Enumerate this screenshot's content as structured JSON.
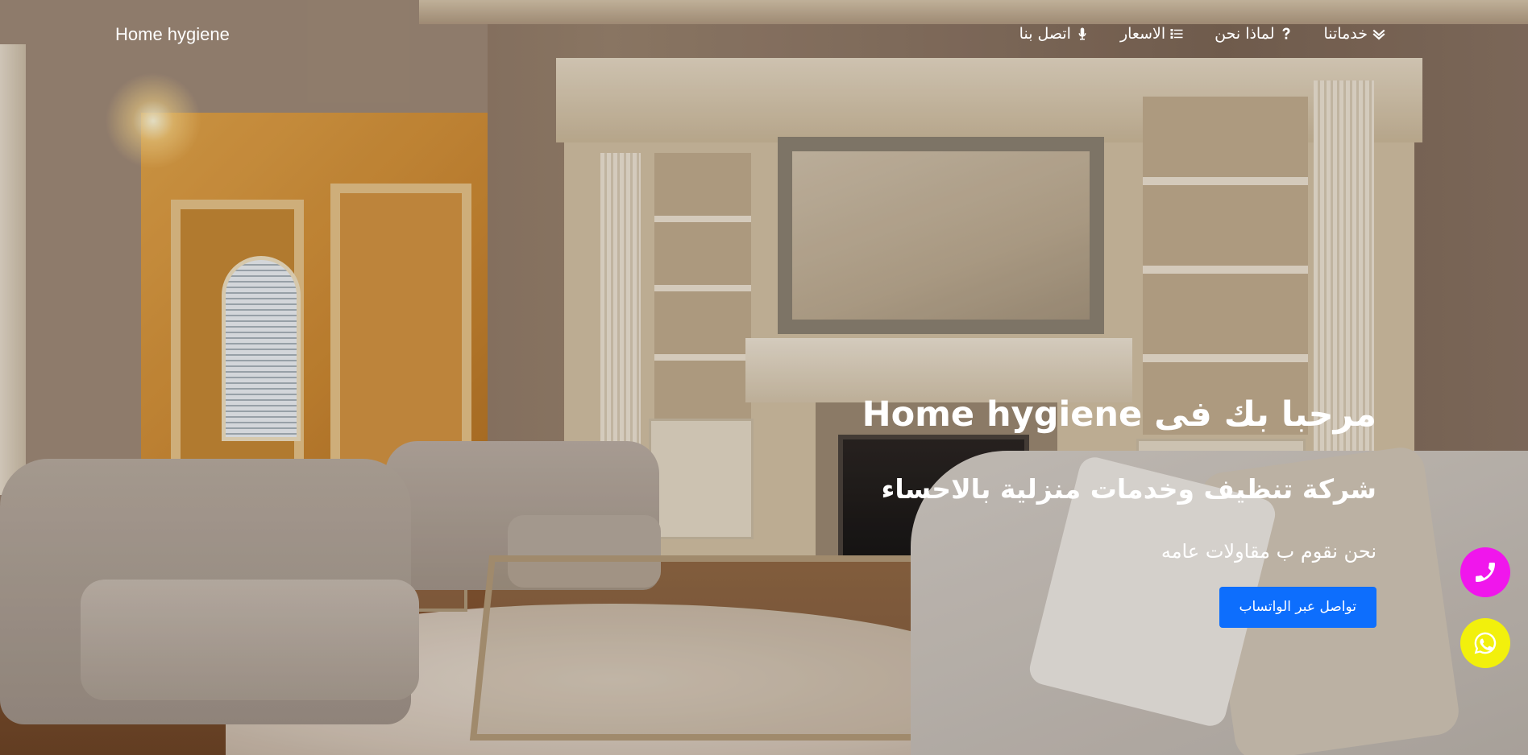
{
  "brand": "Home hygiene",
  "nav": {
    "items": [
      {
        "label": "خدماتنا",
        "icon": "double-chevron-down-icon"
      },
      {
        "label": "لماذا نحن",
        "icon": "question-icon"
      },
      {
        "label": "الاسعار",
        "icon": "list-icon"
      },
      {
        "label": "اتصل بنا",
        "icon": "microphone-icon"
      }
    ]
  },
  "hero": {
    "title": "مرحبا بك فى Home hygiene",
    "subtitle": "شركة تنظيف وخدمات منزلية بالاحساء",
    "description": "نحن نقوم ب مقاولات عامه",
    "cta_label": "تواصل عبر الواتساب"
  },
  "floating": [
    {
      "icon": "phone-icon",
      "color": "#f016ec"
    },
    {
      "icon": "whatsapp-icon",
      "color": "#f2f00c"
    }
  ],
  "colors": {
    "cta": "#0d6efd",
    "text": "#ffffff"
  }
}
